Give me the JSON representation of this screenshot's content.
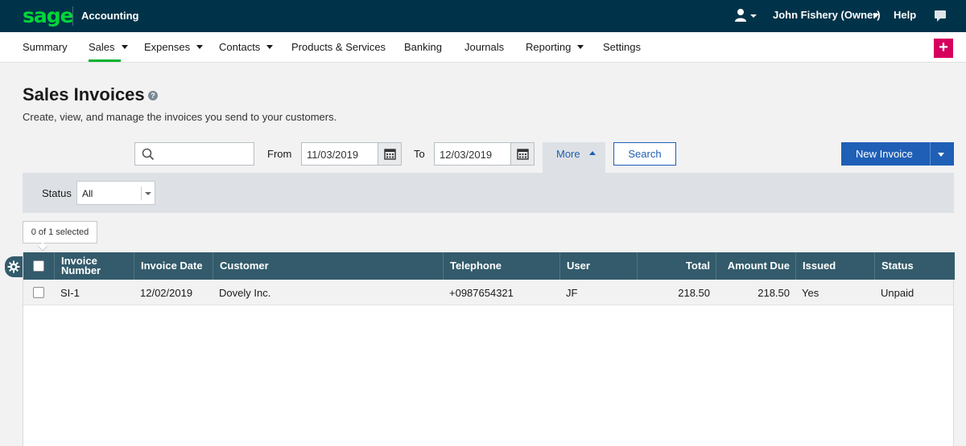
{
  "topbar": {
    "logo": "sage",
    "app_name": "Accounting",
    "user_name": "John Fishery (Owner)",
    "help": "Help"
  },
  "nav": {
    "items": [
      {
        "label": "Summary"
      },
      {
        "label": "Sales"
      },
      {
        "label": "Expenses"
      },
      {
        "label": "Contacts"
      },
      {
        "label": "Products & Services"
      },
      {
        "label": "Banking"
      },
      {
        "label": "Journals"
      },
      {
        "label": "Reporting"
      },
      {
        "label": "Settings"
      }
    ],
    "active": "Sales",
    "plus": "+"
  },
  "page": {
    "title": "Sales Invoices",
    "subtitle": "Create, view, and manage the invoices you send to your customers."
  },
  "filters": {
    "search_value": "",
    "from_label": "From",
    "from_date": "11/03/2019",
    "to_label": "To",
    "to_date": "12/03/2019",
    "more_label": "More",
    "search_button": "Search",
    "new_invoice": "New Invoice",
    "status_label": "Status",
    "status_value": "All"
  },
  "selection": {
    "text": "0 of 1 selected"
  },
  "table": {
    "columns": {
      "invoice_number_1": "Invoice",
      "invoice_number_2": "Number",
      "invoice_date": "Invoice Date",
      "customer": "Customer",
      "telephone": "Telephone",
      "user": "User",
      "total": "Total",
      "amount_due": "Amount Due",
      "issued": "Issued",
      "status": "Status"
    },
    "rows": [
      {
        "invoice_number": "SI-1",
        "invoice_date": "12/02/2019",
        "customer": "Dovely Inc.",
        "telephone": "+0987654321",
        "user": "JF",
        "total": "218.50",
        "amount_due": "218.50",
        "issued": "Yes",
        "status": "Unpaid"
      }
    ]
  },
  "colors": {
    "topbar": "#003349",
    "brand_green": "#00d639",
    "primary_blue": "#1f5fb5",
    "table_header": "#335b6b",
    "plus_button": "#d6005e"
  }
}
